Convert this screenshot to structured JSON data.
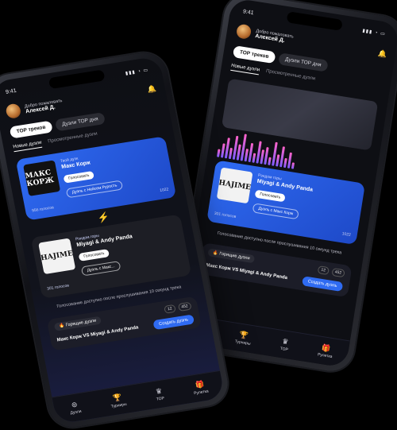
{
  "status": {
    "time": "9:41"
  },
  "greeting": {
    "line1": "Добро пожаловать",
    "name": "Алексей Д."
  },
  "tabs": [
    "ТОР треков",
    "Дуэли ТОР дня"
  ],
  "subtabs": [
    "Новые дуэли",
    "Просмотренные дуэли"
  ],
  "front": {
    "card1": {
      "caption": "Твой дуэк",
      "artist": "Макс Корж",
      "btn1": "Голосовать",
      "btn2": "Дуэль с Нейсем Рурость",
      "left": "956 голосов",
      "right": "1022",
      "cover_text": "МАКС КОРЖ"
    },
    "card2": {
      "caption": "Рэндом горы",
      "artist": "Miyagi & Andy Panda",
      "btn1": "Голосовать",
      "btn2": "Дуэль с Макс...",
      "left": "301 голосов",
      "right": "",
      "cover_text": "HAJIME"
    },
    "note": "Голосование доступно после прослушивания 10 секунд трека",
    "hot": {
      "label": "🔥 Горящие дуэли",
      "c1": "12",
      "c2": "452",
      "vs": "Макс Корж VS Miyagi & Andy Panda",
      "create": "Создать дуэль"
    }
  },
  "back": {
    "card": {
      "caption": "Рэндом горы",
      "artist": "Miyagi & Andy Panda",
      "btn1": "Голосовать",
      "btn2": "Дуэль с Макс Корж",
      "left": "301 голосов",
      "right": "1022",
      "cover_text": "HAJIME"
    },
    "note": "Голосование доступно после прослушивания 10 секунд трека",
    "hot": {
      "label": "🔥 Горящие дуэли",
      "c1": "12",
      "c2": "452",
      "vs": "Макс Корж VS Miyagi & Andy Panda",
      "create": "Создать дуэль"
    }
  },
  "nav": [
    "Дуэли",
    "Турниры",
    "ТОР",
    "Рулетка"
  ],
  "icons": {
    "bell": "bell-icon",
    "bolt": "lightning-icon",
    "plus": "plus-icon"
  },
  "colors": {
    "accent": "#2f6bf2",
    "bolt": "#f4b400",
    "bell": "#ff7b4d"
  }
}
